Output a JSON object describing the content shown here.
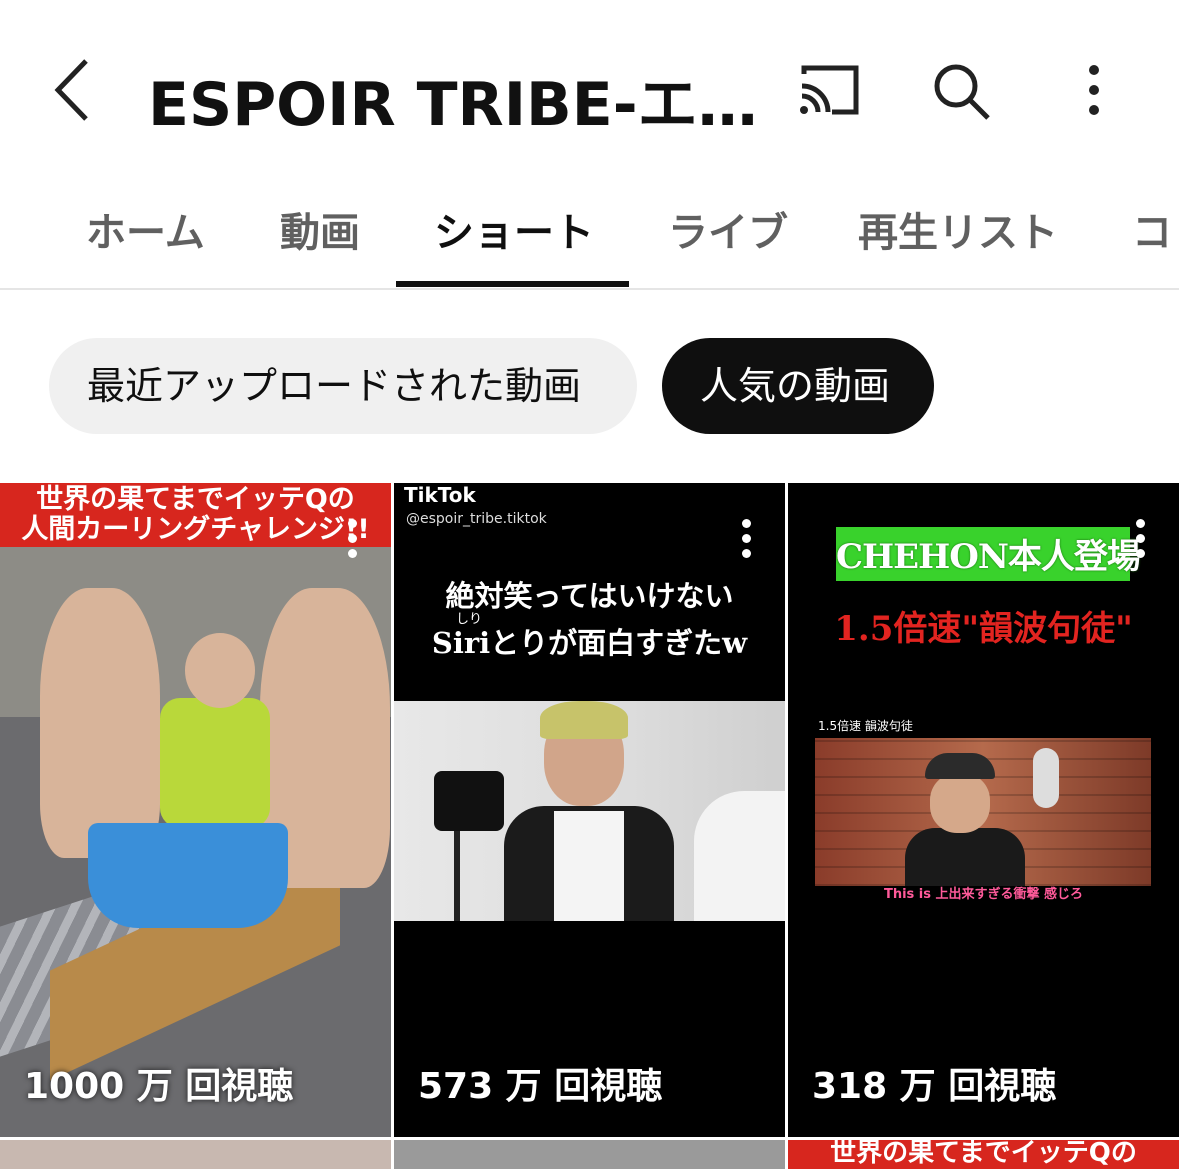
{
  "header": {
    "title": "ESPOIR TRIBE-エ…"
  },
  "tabs": [
    {
      "label": "ホーム"
    },
    {
      "label": "動画"
    },
    {
      "label": "ショート"
    },
    {
      "label": "ライブ"
    },
    {
      "label": "再生リスト"
    },
    {
      "label": "コ"
    }
  ],
  "active_tab": "ショート",
  "chips": [
    {
      "label": "最近アップロードされた動画",
      "selected": false
    },
    {
      "label": "人気の動画",
      "selected": true
    }
  ],
  "shorts": [
    {
      "views": "1000 万 回視聴",
      "caption_line1": "世界の果てまでイッテQの",
      "caption_line2": "人間カーリングチャレンジ!!"
    },
    {
      "views": "573 万 回視聴",
      "brand": "TikTok",
      "handle": "@espoir_tribe.tiktok",
      "caption_line1": "絶対笑ってはいけない",
      "ruby": "しり",
      "caption_line2": "Siriとりが面白すぎたw"
    },
    {
      "views": "318 万 回視聴",
      "green_title": "CHEHON本人登場",
      "red_title": "1.5倍速\"韻波句徒\"",
      "small_label": "1.5倍速 韻波句徒",
      "subtitle": "This is 上出来すぎる衝撃 感じろ"
    }
  ],
  "next_row_peek": {
    "caption": "世界の果てまでイッテQの"
  },
  "colors": {
    "accent_red": "#d7261e",
    "green_banner": "#39d22c",
    "chip_active_bg": "#0f0f0f",
    "chip_inactive_bg": "#f0f0f0"
  }
}
